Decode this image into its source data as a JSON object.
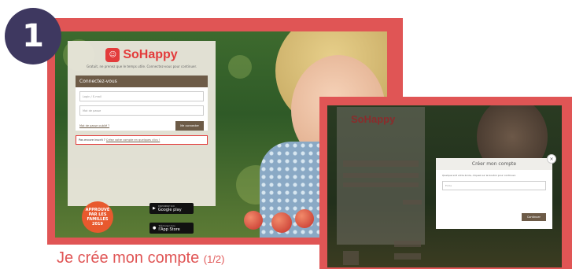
{
  "step": "1",
  "brand": {
    "icon": "☺",
    "name": "SoHappy"
  },
  "screen1": {
    "tagline": "Gratuit, ne prenez que le temps utile. Connectez-vous pour continuer.",
    "login_title": "Connectez-vous",
    "login_placeholder": "Login / E-mail",
    "password_placeholder": "Mot de passe",
    "forgot_label": "Mot de passe oublié ?",
    "connect_button": "Me connecter",
    "signup_prompt": "Pas encore inscrit ?",
    "signup_link": "Créez votre compte en quelques clics !",
    "award_line1": "APPROUVÉ",
    "award_line2": "PAR LES FAMILLES",
    "award_year": "2019",
    "google_play_sub": "DISPONIBLE SUR",
    "google_play": "Google play",
    "app_store_sub": "Télécharger dans",
    "app_store": "l'App Store"
  },
  "caption": {
    "main": "Je crée mon compte",
    "step": "(1/2)"
  },
  "screen2": {
    "modal_title": "Créer mon compte",
    "modal_text": "Quelque soit votre école, cliquez sur le bouton pour continuer.",
    "modal_input_placeholder": "Ecole",
    "modal_button": "Continuer",
    "close_symbol": "×"
  }
}
